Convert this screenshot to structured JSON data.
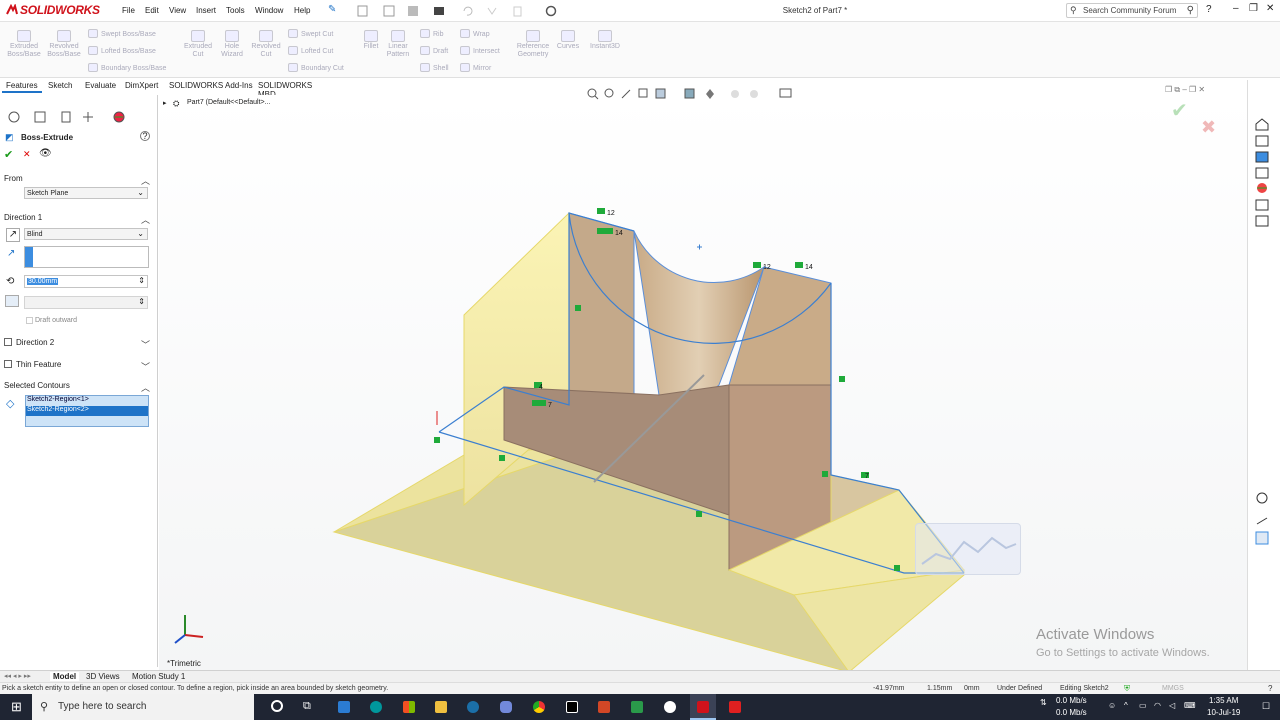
{
  "app": {
    "brand": "SOLIDWORKS",
    "doc_title": "Sketch2 of Part7 *"
  },
  "menu": [
    "File",
    "Edit",
    "View",
    "Insert",
    "Tools",
    "Window",
    "Help"
  ],
  "search": {
    "placeholder": "Search Community Forum"
  },
  "ribbon": {
    "big": [
      {
        "label1": "Extruded",
        "label2": "Boss/Base"
      },
      {
        "label1": "Revolved",
        "label2": "Boss/Base"
      },
      {
        "label1": "Extruded",
        "label2": "Cut"
      },
      {
        "label1": "Hole",
        "label2": "Wizard"
      },
      {
        "label1": "Revolved",
        "label2": "Cut"
      },
      {
        "label1": "Fillet",
        "label2": ""
      },
      {
        "label1": "Linear",
        "label2": "Pattern"
      },
      {
        "label1": "Reference",
        "label2": "Geometry"
      },
      {
        "label1": "Curves",
        "label2": ""
      },
      {
        "label1": "Instant3D",
        "label2": ""
      }
    ],
    "small": [
      "Swept Boss/Base",
      "Lofted Boss/Base",
      "Boundary Boss/Base",
      "Swept Cut",
      "Lofted Cut",
      "Boundary Cut",
      "Rib",
      "Draft",
      "Shell",
      "Wrap",
      "Intersect",
      "Mirror"
    ]
  },
  "tabs": [
    "Features",
    "Sketch",
    "Evaluate",
    "DimXpert",
    "SOLIDWORKS Add-Ins",
    "SOLIDWORKS MBD"
  ],
  "tree": {
    "root": "Part7  (Default<<Default>..."
  },
  "pm": {
    "title": "Boss-Extrude",
    "from_label": "From",
    "from_value": "Sketch Plane",
    "dir1_label": "Direction 1",
    "end_condition": "Blind",
    "depth": "30.00mm",
    "draft_outward": "Draft outward",
    "dir2_label": "Direction 2",
    "thin_label": "Thin Feature",
    "contours_label": "Selected Contours",
    "contours": [
      "Sketch2-Region<1>",
      "Sketch2-Region<2>"
    ]
  },
  "viewport": {
    "view_name": "*Trimetric",
    "watermark1": "Activate Windows",
    "watermark2": "Go to Settings to activate Windows.",
    "relations": [
      "12",
      "14",
      "12",
      "14",
      "7",
      "7",
      "4"
    ]
  },
  "bottom_tabs": [
    "Model",
    "3D Views",
    "Motion Study 1"
  ],
  "status": {
    "hint": "Pick a sketch entity to define an open or closed contour. To define a region, pick inside an area bounded by sketch geometry.",
    "x": "-41.97mm",
    "y": "1.15mm",
    "z": "0mm",
    "state": "Under Defined",
    "editing": "Editing Sketch2",
    "units": "MMGS"
  },
  "taskbar": {
    "search_placeholder": "Type here to search",
    "net_up": "0.0 Mb/s",
    "net_down": "0.0 Mb/s",
    "time": "1:35 AM",
    "date": "10-Jul-19"
  },
  "colors": {
    "accent": "#1e73c8",
    "brand_red": "#d0121b",
    "face_yellow": "#f7f0a0",
    "face_tan": "#c9ab88",
    "sketch_blue": "#3b7fd0"
  }
}
